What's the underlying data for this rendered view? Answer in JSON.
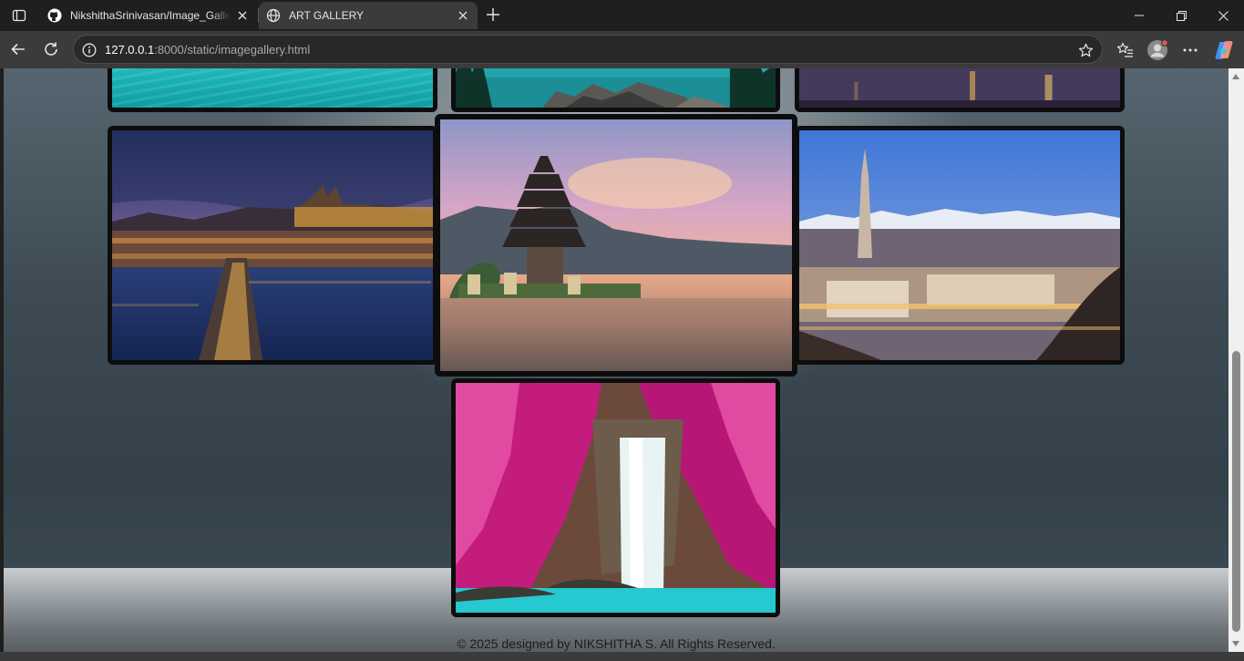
{
  "browser": {
    "tabs": [
      {
        "title": "NikshithaSrinivasan/Image_Gallery",
        "favicon": "github-icon",
        "active": false
      },
      {
        "title": "ART GALLERY",
        "favicon": "globe-icon",
        "active": true
      }
    ],
    "address": {
      "host": "127.0.0.1",
      "path": ":8000/static/imagegallery.html"
    }
  },
  "gallery": {
    "images": [
      {
        "name": "turquoise-sea",
        "colors": [
          "#2fc2c4",
          "#14a3a8"
        ]
      },
      {
        "name": "mountain-lake-rocks",
        "colors": [
          "#1b8e96",
          "#4f4f4d"
        ]
      },
      {
        "name": "night-harbor",
        "colors": [
          "#3b2f50",
          "#c79a52"
        ]
      },
      {
        "name": "prague-night-bridge",
        "colors": [
          "#262d62",
          "#f0a33c"
        ]
      },
      {
        "name": "bali-temple-sunset",
        "colors": [
          "#c9a5c9",
          "#e9a070"
        ]
      },
      {
        "name": "turin-cityscape-dusk",
        "colors": [
          "#4c7fd3",
          "#e3c48e"
        ]
      },
      {
        "name": "pink-forest-waterfall",
        "colors": [
          "#d2197f",
          "#2ed3d5"
        ]
      }
    ]
  },
  "footer": {
    "text": "© 2025 designed by NIKSHITHA S. All Rights Reserved."
  }
}
